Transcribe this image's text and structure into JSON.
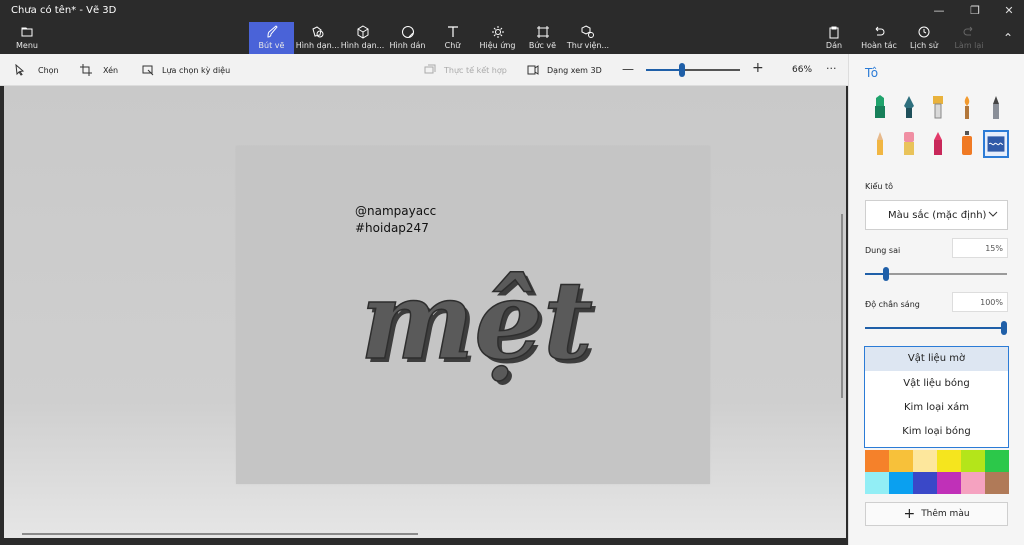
{
  "window": {
    "title": "Chưa có tên* - Vẽ 3D"
  },
  "toolbar": {
    "menu": "Menu",
    "left_items": [
      {
        "label": "Bút vẽ",
        "icon": "brush-icon",
        "active": true
      },
      {
        "label": "Hình dạn...",
        "icon": "2d-shapes-icon"
      },
      {
        "label": "Hình dạn...",
        "icon": "3d-shapes-icon"
      },
      {
        "label": "Hình dán",
        "icon": "stickers-icon"
      },
      {
        "label": "Chữ",
        "icon": "text-icon"
      },
      {
        "label": "Hiệu ứng",
        "icon": "effects-icon"
      },
      {
        "label": "Bức vẽ",
        "icon": "canvas-icon"
      },
      {
        "label": "Thư viện...",
        "icon": "library-icon"
      }
    ],
    "right_items": [
      {
        "label": "Dán",
        "icon": "paste-icon"
      },
      {
        "label": "Hoàn tác",
        "icon": "undo-icon"
      },
      {
        "label": "Lịch sử",
        "icon": "history-icon"
      },
      {
        "label": "Làm lại",
        "icon": "redo-icon",
        "disabled": true
      }
    ]
  },
  "subbar": {
    "select": "Chọn",
    "crop": "Xén",
    "magic_select": "Lựa chọn kỳ diệu",
    "mixed_reality": "Thực tế kết hợp",
    "view_3d": "Dạng xem 3D",
    "zoom": "66%",
    "zoom_level": 0.38,
    "more": "···"
  },
  "canvas": {
    "line1": "@nampayacc",
    "line2": "#hoidap247",
    "word": "mệt"
  },
  "panel": {
    "heading": "Tô",
    "brush_style_label": "Kiểu tô",
    "brush_style_value": "Màu sắc (mặc định)",
    "tolerance_label": "Dung sai",
    "tolerance_value": "15%",
    "tolerance_level": 0.15,
    "opacity_label": "Độ chắn sáng",
    "opacity_value": "100%",
    "opacity_level": 1.0,
    "materials": [
      "Vật liệu mờ",
      "Vật liệu bóng",
      "Kim loại xám",
      "Kim loại bóng"
    ],
    "palette": [
      "#f5812a",
      "#f7c13a",
      "#fde79c",
      "#f5e51e",
      "#b4e51a",
      "#2cc84a",
      "#92eef5",
      "#0aa0f0",
      "#3a48c8",
      "#c030b8",
      "#f5a2c0",
      "#b07a58"
    ],
    "add_color": "Thêm màu"
  }
}
